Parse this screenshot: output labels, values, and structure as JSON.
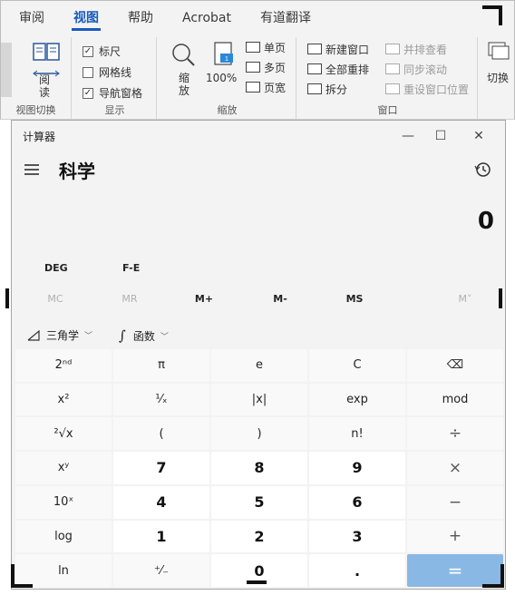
{
  "ribbon": {
    "tabs": [
      "审阅",
      "视图",
      "帮助",
      "Acrobat",
      "有道翻译"
    ],
    "active_tab": 1,
    "views_group": {
      "read_mode": "阅\n读",
      "label": "视图切换"
    },
    "show_group": {
      "items": [
        {
          "label": "标尺",
          "checked": true
        },
        {
          "label": "网格线",
          "checked": false
        },
        {
          "label": "导航窗格",
          "checked": true
        }
      ],
      "label": "显示"
    },
    "zoom_group": {
      "zoom_label": "缩\n放",
      "hundred": "100%",
      "pages": [
        "单页",
        "多页",
        "页宽"
      ],
      "label": "缩放"
    },
    "window_group": {
      "items": [
        "新建窗口",
        "全部重排",
        "拆分"
      ],
      "dim_items": [
        "并排查看",
        "同步滚动",
        "重设窗口位置"
      ],
      "label": "窗口",
      "switch": "切换"
    }
  },
  "calculator": {
    "app_title": "计算器",
    "mode": "科学",
    "display_value": "0",
    "angle_unit": "DEG",
    "fe_label": "F-E",
    "memory": [
      {
        "label": "MC",
        "enabled": false
      },
      {
        "label": "MR",
        "enabled": false
      },
      {
        "label": "M+",
        "enabled": true
      },
      {
        "label": "M-",
        "enabled": true
      },
      {
        "label": "MS",
        "enabled": true
      },
      {
        "label": "M˅",
        "enabled": false
      }
    ],
    "trig_label": "三角学",
    "func_label": "函数",
    "keys": [
      {
        "label": "2ⁿᵈ",
        "type": "fn"
      },
      {
        "label": "π",
        "type": "fn"
      },
      {
        "label": "e",
        "type": "fn"
      },
      {
        "label": "C",
        "type": "fn"
      },
      {
        "label": "⌫",
        "type": "fn"
      },
      {
        "label": "x²",
        "type": "fn"
      },
      {
        "label": "¹⁄ₓ",
        "type": "fn"
      },
      {
        "label": "|x|",
        "type": "fn"
      },
      {
        "label": "exp",
        "type": "fn"
      },
      {
        "label": "mod",
        "type": "fn"
      },
      {
        "label": "²√x",
        "type": "fn"
      },
      {
        "label": "(",
        "type": "fn"
      },
      {
        "label": ")",
        "type": "fn"
      },
      {
        "label": "n!",
        "type": "fn"
      },
      {
        "label": "÷",
        "type": "op"
      },
      {
        "label": "xʸ",
        "type": "fn"
      },
      {
        "label": "7",
        "type": "num"
      },
      {
        "label": "8",
        "type": "num"
      },
      {
        "label": "9",
        "type": "num"
      },
      {
        "label": "×",
        "type": "op"
      },
      {
        "label": "10ˣ",
        "type": "fn"
      },
      {
        "label": "4",
        "type": "num"
      },
      {
        "label": "5",
        "type": "num"
      },
      {
        "label": "6",
        "type": "num"
      },
      {
        "label": "−",
        "type": "op"
      },
      {
        "label": "log",
        "type": "fn"
      },
      {
        "label": "1",
        "type": "num"
      },
      {
        "label": "2",
        "type": "num"
      },
      {
        "label": "3",
        "type": "num"
      },
      {
        "label": "+",
        "type": "op"
      },
      {
        "label": "ln",
        "type": "fn"
      },
      {
        "label": "⁺⁄₋",
        "type": "fn"
      },
      {
        "label": "0",
        "type": "num"
      },
      {
        "label": ".",
        "type": "num"
      },
      {
        "label": "=",
        "type": "eq"
      }
    ]
  }
}
